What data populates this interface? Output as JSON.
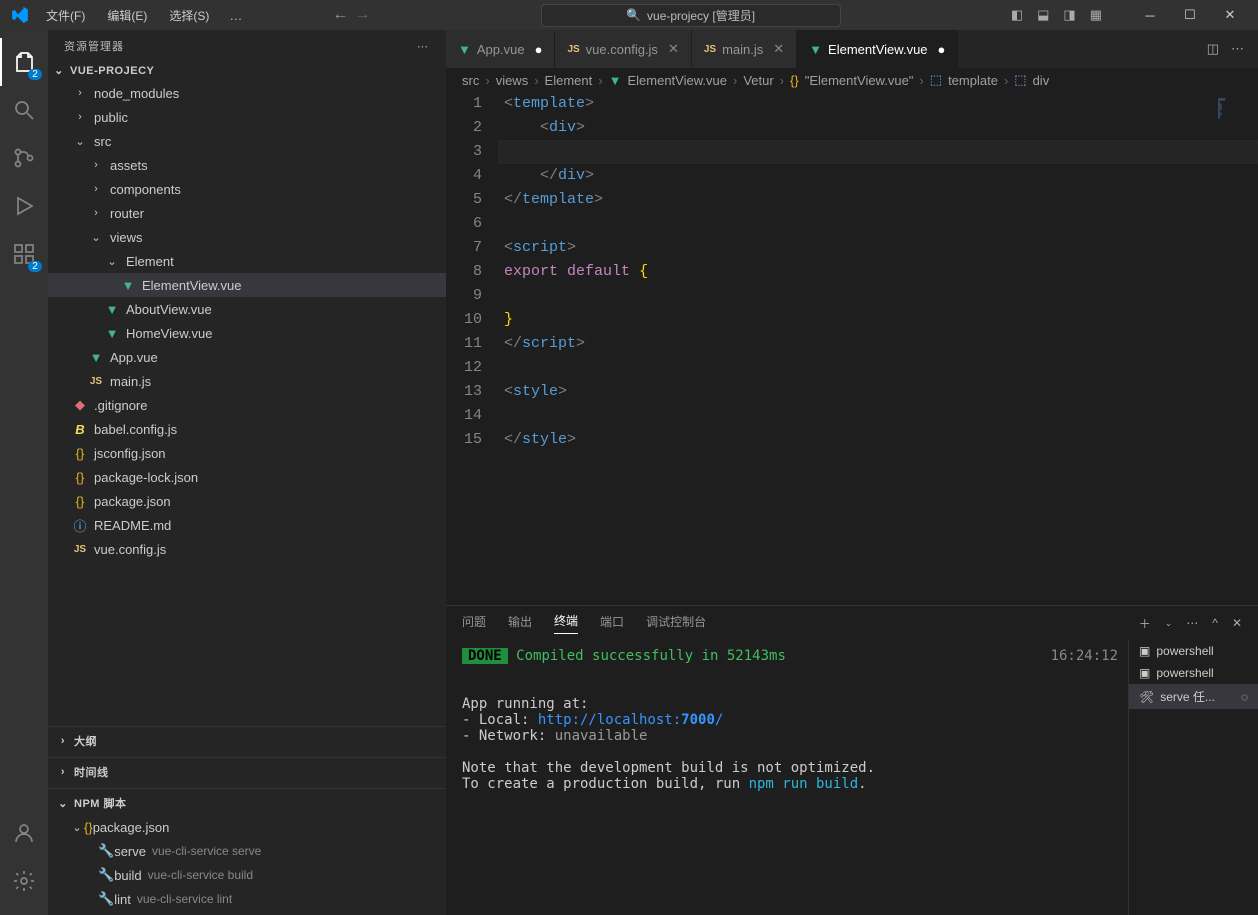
{
  "titlebar": {
    "menu": [
      "文件(F)",
      "编辑(E)",
      "选择(S)"
    ],
    "menu_more": "…",
    "search": "vue-projecy [管理员]"
  },
  "activity_badge_explorer": "2",
  "activity_badge_ext": "2",
  "sidebar": {
    "header": "资源管理器",
    "project": "VUE-PROJECY",
    "tree": [
      {
        "type": "folder",
        "name": "node_modules",
        "depth": 1,
        "open": false
      },
      {
        "type": "folder",
        "name": "public",
        "depth": 1,
        "open": false
      },
      {
        "type": "folder",
        "name": "src",
        "depth": 1,
        "open": true
      },
      {
        "type": "folder",
        "name": "assets",
        "depth": 2,
        "open": false
      },
      {
        "type": "folder",
        "name": "components",
        "depth": 2,
        "open": false
      },
      {
        "type": "folder",
        "name": "router",
        "depth": 2,
        "open": false
      },
      {
        "type": "folder",
        "name": "views",
        "depth": 2,
        "open": true
      },
      {
        "type": "folder",
        "name": "Element",
        "depth": 3,
        "open": true
      },
      {
        "type": "file",
        "name": "ElementView.vue",
        "icon": "vue",
        "depth": 4,
        "selected": true
      },
      {
        "type": "file",
        "name": "AboutView.vue",
        "icon": "vue",
        "depth": 3
      },
      {
        "type": "file",
        "name": "HomeView.vue",
        "icon": "vue",
        "depth": 3
      },
      {
        "type": "file",
        "name": "App.vue",
        "icon": "vue",
        "depth": 2
      },
      {
        "type": "file",
        "name": "main.js",
        "icon": "js",
        "depth": 2
      },
      {
        "type": "file",
        "name": ".gitignore",
        "icon": "git",
        "depth": 1
      },
      {
        "type": "file",
        "name": "babel.config.js",
        "icon": "babel",
        "depth": 1
      },
      {
        "type": "file",
        "name": "jsconfig.json",
        "icon": "json",
        "depth": 1
      },
      {
        "type": "file",
        "name": "package-lock.json",
        "icon": "json",
        "depth": 1
      },
      {
        "type": "file",
        "name": "package.json",
        "icon": "json",
        "depth": 1
      },
      {
        "type": "file",
        "name": "README.md",
        "icon": "info",
        "depth": 1
      },
      {
        "type": "file",
        "name": "vue.config.js",
        "icon": "js",
        "depth": 1
      }
    ],
    "outline": "大纲",
    "timeline": "时间线",
    "npm_title": "NPM 脚本",
    "npm": {
      "root": "package.json",
      "scripts": [
        {
          "name": "serve",
          "desc": "vue-cli-service serve"
        },
        {
          "name": "build",
          "desc": "vue-cli-service build"
        },
        {
          "name": "lint",
          "desc": "vue-cli-service lint"
        }
      ]
    }
  },
  "tabs": [
    {
      "label": "App.vue",
      "icon": "vue",
      "dirty": true
    },
    {
      "label": "vue.config.js",
      "icon": "js"
    },
    {
      "label": "main.js",
      "icon": "js"
    },
    {
      "label": "ElementView.vue",
      "icon": "vue",
      "active": true,
      "dirty": true
    }
  ],
  "breadcrumb": [
    "src",
    "views",
    "Element",
    "ElementView.vue",
    "Vetur",
    "\"ElementView.vue\"",
    "template",
    "div"
  ],
  "breadcrumb_icons": [
    "",
    "",
    "",
    "vue",
    "",
    "json",
    "tag",
    "tag"
  ],
  "code_lines": [
    [
      {
        "c": "brkt",
        "t": "<"
      },
      {
        "c": "tag",
        "t": "template"
      },
      {
        "c": "brkt",
        "t": ">"
      }
    ],
    [
      {
        "c": "plain",
        "t": "    "
      },
      {
        "c": "brkt",
        "t": "<"
      },
      {
        "c": "tag",
        "t": "div"
      },
      {
        "c": "brkt",
        "t": ">"
      }
    ],
    [],
    [
      {
        "c": "plain",
        "t": "    "
      },
      {
        "c": "brkt",
        "t": "</"
      },
      {
        "c": "tag",
        "t": "div"
      },
      {
        "c": "brkt",
        "t": ">"
      }
    ],
    [
      {
        "c": "brkt",
        "t": "</"
      },
      {
        "c": "tag",
        "t": "template"
      },
      {
        "c": "brkt",
        "t": ">"
      }
    ],
    [],
    [
      {
        "c": "brkt",
        "t": "<"
      },
      {
        "c": "tag",
        "t": "script"
      },
      {
        "c": "brkt",
        "t": ">"
      }
    ],
    [
      {
        "c": "kw",
        "t": "export"
      },
      {
        "c": "plain",
        "t": " "
      },
      {
        "c": "kw",
        "t": "default"
      },
      {
        "c": "plain",
        "t": " "
      },
      {
        "c": "brace",
        "t": "{"
      }
    ],
    [],
    [
      {
        "c": "brace",
        "t": "}"
      }
    ],
    [
      {
        "c": "brkt",
        "t": "</"
      },
      {
        "c": "tag",
        "t": "script"
      },
      {
        "c": "brkt",
        "t": ">"
      }
    ],
    [],
    [
      {
        "c": "brkt",
        "t": "<"
      },
      {
        "c": "tag",
        "t": "style"
      },
      {
        "c": "brkt",
        "t": ">"
      }
    ],
    [],
    [
      {
        "c": "brkt",
        "t": "</"
      },
      {
        "c": "tag",
        "t": "style"
      },
      {
        "c": "brkt",
        "t": ">"
      }
    ]
  ],
  "panel": {
    "tabs": [
      "问题",
      "输出",
      "终端",
      "端口",
      "调试控制台"
    ],
    "active_tab": 2,
    "time": "16:24:12",
    "done": "DONE",
    "compiled": "Compiled successfully in 52143ms",
    "lines": [
      "App running at:",
      "- Local:   ",
      "- Network: "
    ],
    "local_url_pre": "http://localhost:",
    "local_port": "7000",
    "local_url_post": "/",
    "network_unavailable": "unavailable",
    "note1": "Note that the development build is not optimized.",
    "note2_pre": "To create a production build, run ",
    "note2_cmd": "npm run build",
    "note2_post": ".",
    "shells": [
      {
        "name": "powershell",
        "icon": "ps"
      },
      {
        "name": "powershell",
        "icon": "ps"
      },
      {
        "name": "serve 任...",
        "icon": "wrench",
        "selected": true
      }
    ]
  }
}
